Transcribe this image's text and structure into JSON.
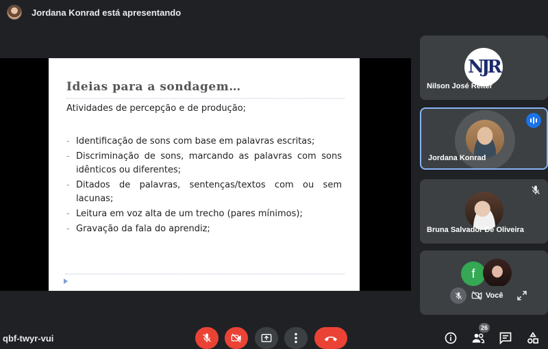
{
  "top": {
    "presenting_text": "Jordana Konrad está apresentando"
  },
  "slide": {
    "title": "Ideias para a sondagem…",
    "subtitle": "Atividades de percepção e de produção;",
    "bullets": [
      "Identificação de sons com base em palavras escritas;",
      "Discriminação de sons, marcando as palavras com sons idênticos ou diferentes;",
      "Ditados de palavras, sentenças/textos com ou sem lacunas;",
      "Leitura em voz alta de um trecho (pares mínimos);",
      "Gravação da fala do aprendiz;"
    ]
  },
  "participants": [
    {
      "name": "Nilson José Reiter",
      "logo_text": "NJR"
    },
    {
      "name": "Jordana Konrad",
      "speaking": true
    },
    {
      "name": "Bruna Salvador De Oliveira",
      "muted": true
    },
    {
      "name": "Você",
      "avatar_letter": "f"
    }
  ],
  "bottom": {
    "meeting_code": "qbf-twyr-vui",
    "people_count": "26"
  },
  "colors": {
    "accent": "#8ab4f8",
    "danger": "#ea4335",
    "speaking": "#1a73e8",
    "avatar_f": "#34a853"
  }
}
